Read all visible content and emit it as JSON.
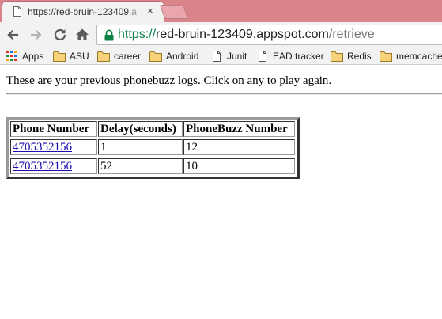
{
  "browser": {
    "tab": {
      "title": "https://red-bruin-123409.a",
      "close_symbol": "×"
    },
    "address_bar": {
      "scheme": "https://",
      "host": "red-bruin-123409.appspot.com",
      "path": "/retrieve"
    },
    "bookmarks": [
      {
        "label": "Apps",
        "icon": "apps-grid-icon"
      },
      {
        "label": "ASU",
        "icon": "folder-icon"
      },
      {
        "label": "career",
        "icon": "folder-icon"
      },
      {
        "label": "Android",
        "icon": "folder-icon"
      },
      {
        "label": "Junit",
        "icon": "page-icon"
      },
      {
        "label": "EAD tracker",
        "icon": "page-icon"
      },
      {
        "label": "Redis",
        "icon": "folder-icon"
      },
      {
        "label": "memcache",
        "icon": "folder-icon"
      }
    ],
    "colors": {
      "tabstrip": "#d9838b",
      "toolbar": "#f2f2f2",
      "secure_scheme": "#0b8043",
      "link": "#1a0dab",
      "folder": "#e8c15b"
    }
  },
  "page": {
    "intro": "These are your previous phonebuzz logs. Click on any to play again.",
    "table": {
      "headers": [
        "Phone Number",
        "Delay(seconds)",
        "PhoneBuzz Number"
      ],
      "rows": [
        {
          "phone": "4705352156",
          "delay": "1",
          "buzz": "12"
        },
        {
          "phone": "4705352156",
          "delay": "52",
          "buzz": "10"
        }
      ]
    }
  }
}
